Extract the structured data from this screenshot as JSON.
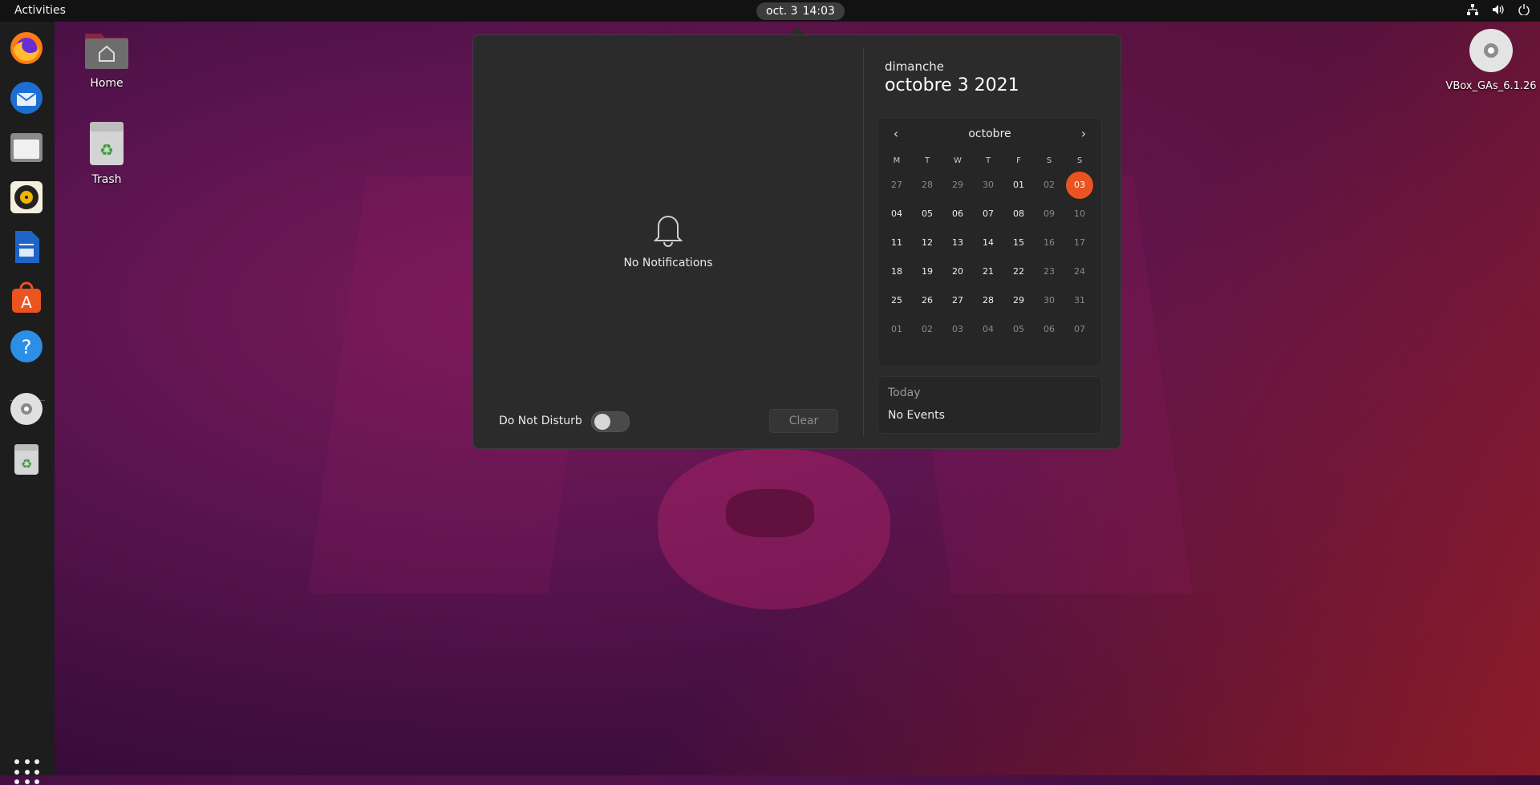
{
  "topbar": {
    "activities": "Activities",
    "clock_date": "oct. 3",
    "clock_time": "14:03",
    "tray": [
      "network-icon",
      "volume-icon",
      "power-icon"
    ]
  },
  "dock": {
    "items": [
      "firefox-icon",
      "thunderbird-icon",
      "files-icon",
      "rhythmbox-icon",
      "writer-icon",
      "software-icon",
      "help-icon",
      "disc-icon",
      "trash-icon"
    ],
    "show_apps": "app-grid-icon"
  },
  "desktop": {
    "home_label": "Home",
    "trash_label": "Trash",
    "vbox_label": "VBox_GAs_6.1.26"
  },
  "notifications": {
    "empty_text": "No Notifications",
    "dnd_label": "Do Not Disturb",
    "clear_label": "Clear"
  },
  "calendar": {
    "day_name": "dimanche",
    "full_date": "octobre 3 2021",
    "month": "octobre",
    "weekdays": [
      "M",
      "T",
      "W",
      "T",
      "F",
      "S",
      "S"
    ],
    "weeks": [
      [
        "27",
        "28",
        "29",
        "30",
        "01",
        "02",
        "03"
      ],
      [
        "04",
        "05",
        "06",
        "07",
        "08",
        "09",
        "10"
      ],
      [
        "11",
        "12",
        "13",
        "14",
        "15",
        "16",
        "17"
      ],
      [
        "18",
        "19",
        "20",
        "21",
        "22",
        "23",
        "24"
      ],
      [
        "25",
        "26",
        "27",
        "28",
        "29",
        "30",
        "31"
      ],
      [
        "01",
        "02",
        "03",
        "04",
        "05",
        "06",
        "07"
      ]
    ],
    "today": "03",
    "accent": "#e95420"
  },
  "events": {
    "title": "Today",
    "empty": "No Events"
  }
}
